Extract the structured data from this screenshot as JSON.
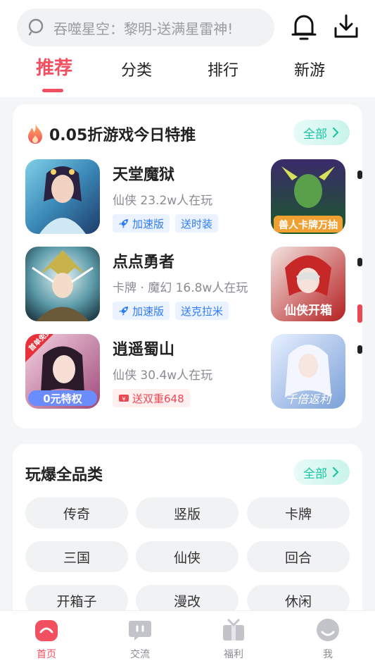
{
  "search": {
    "placeholder": "吞噬星空：黎明-送满星雷神!"
  },
  "tabs": [
    {
      "label": "推荐",
      "active": true
    },
    {
      "label": "分类",
      "active": false
    },
    {
      "label": "排行",
      "active": false
    },
    {
      "label": "新游",
      "active": false
    }
  ],
  "featured": {
    "title": "0.05折游戏今日特推",
    "all_label": "全部",
    "games": [
      {
        "name": "天堂魔狱",
        "meta": "仙侠  23.2w人在玩",
        "tags": [
          {
            "text": "加速版",
            "style": "blue",
            "icon": "rocket-icon"
          },
          {
            "text": "送时装",
            "style": "blue"
          }
        ]
      },
      {
        "name": "点点勇者",
        "meta": "卡牌 · 魔幻  16.8w人在玩",
        "tags": [
          {
            "text": "加速版",
            "style": "blue",
            "icon": "rocket-icon"
          },
          {
            "text": "送克拉米",
            "style": "blue"
          }
        ]
      },
      {
        "name": "逍遥蜀山",
        "meta": "仙侠  30.4w人在玩",
        "tags": [
          {
            "text": "送双重648",
            "style": "red",
            "icon": "ticket-icon"
          }
        ]
      }
    ],
    "side_thumb_texts": [
      "兽人卡牌万抽",
      "仙侠开箱",
      "千倍返利"
    ],
    "badge_texts": {
      "first_free": "首单免费",
      "zero_privilege": "0元特权"
    }
  },
  "categories": {
    "title": "玩爆全品类",
    "all_label": "全部",
    "items": [
      "传奇",
      "竖版",
      "卡牌",
      "三国",
      "仙侠",
      "回合",
      "开箱子",
      "漫改",
      "休闲"
    ]
  },
  "bottom_nav": [
    {
      "label": "首页",
      "active": true
    },
    {
      "label": "交流",
      "active": false
    },
    {
      "label": "福利",
      "active": false
    },
    {
      "label": "我",
      "active": false
    }
  ],
  "colors": {
    "accent": "#f0505f",
    "teal": "#1ec4a2",
    "blue_tag": "#2f7bf5",
    "red_tag": "#ec4854"
  }
}
